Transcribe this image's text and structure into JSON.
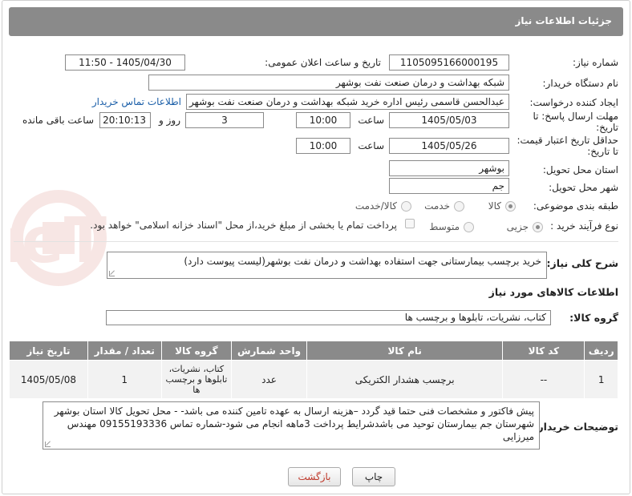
{
  "header": {
    "title": "جزئیات اطلاعات نیاز"
  },
  "fields": {
    "need_number_label": "شماره نیاز:",
    "need_number": "1105095166000195",
    "announce_label": "تاریخ و ساعت اعلان عمومی:",
    "announce_value": "1405/04/30 - 11:50",
    "buyer_org_label": "نام دستگاه خریدار:",
    "buyer_org": "شبکه بهداشت و درمان صنعت نفت بوشهر",
    "requester_label": "ایجاد کننده درخواست:",
    "requester": "عبدالحسن قاسمی رئیس اداره خرید  شبکه بهداشت و درمان صنعت نفت بوشهر",
    "buyer_contact_link": "اطلاعات تماس خریدار",
    "reply_deadline_label_1": "مهلت ارسال پاسخ: تا",
    "reply_deadline_label_2": "تاریخ:",
    "reply_date": "1405/05/03",
    "time_label": "ساعت",
    "reply_time": "10:00",
    "days_value": "3",
    "days_label": "روز و",
    "remaining_time": "20:10:13",
    "remaining_label": "ساعت باقی مانده",
    "price_deadline_label_1": "حداقل تاریخ اعتبار قیمت:",
    "price_deadline_label_2": "تا تاریخ:",
    "price_date": "1405/05/26",
    "price_time": "10:00",
    "province_label": "استان محل تحویل:",
    "province": "بوشهر",
    "city_label": "شهر محل تحویل:",
    "city": "جم",
    "category_label": "طبقه بندی موضوعی:",
    "category_options": [
      "کالا",
      "خدمت",
      "کالا/خدمت"
    ],
    "process_label": "نوع فرآیند خرید :",
    "process_options": [
      "جزیی",
      "متوسط"
    ],
    "payment_note": "پرداخت تمام یا بخشی از مبلغ خرید،از محل \"اسناد خزانه اسلامی\" خواهد بود."
  },
  "description": {
    "label": "شرح کلی نیاز:",
    "value": "خرید برچسب بیمارستانی جهت استفاده بهداشت و درمان نفت بوشهر(لیست پیوست دارد)"
  },
  "goods": {
    "section_title": "اطلاعات کالاهای مورد نیاز",
    "group_label": "گروه کالا:",
    "group_value": "کتاب، نشریات، تابلوها و برچسب ها",
    "columns": [
      "ردیف",
      "کد کالا",
      "نام کالا",
      "واحد شمارش",
      "گروه کالا",
      "تعداد / مقدار",
      "تاریخ نیاز"
    ],
    "rows": [
      {
        "row": "1",
        "code": "--",
        "name": "برچسب هشدار الکتریکی",
        "unit": "عدد",
        "group": "کتاب، نشریات، تابلوها و برچسب ها",
        "qty": "1",
        "date": "1405/05/08"
      }
    ]
  },
  "buyer_notes": {
    "label": "توضیحات خریدار:",
    "value": "پیش فاکتور و مشخصات فنی حتما قید گردد –هزینه ارسال به عهده تامین کننده می باشد- - محل تحویل کالا استان بوشهر شهرستان جم بیمارستان توحید می باشدشرایط پرداخت 3ماهه انجام می شود-شماره تماس 09155193336 مهندس میرزایی"
  },
  "buttons": {
    "print": "چاپ",
    "back": "بازگشت"
  },
  "watermark_text": "AriaTender.neT",
  "colors": {
    "header_bg": "#8a8a8a",
    "link": "#1a5ea8",
    "back_text": "#c0392b"
  }
}
